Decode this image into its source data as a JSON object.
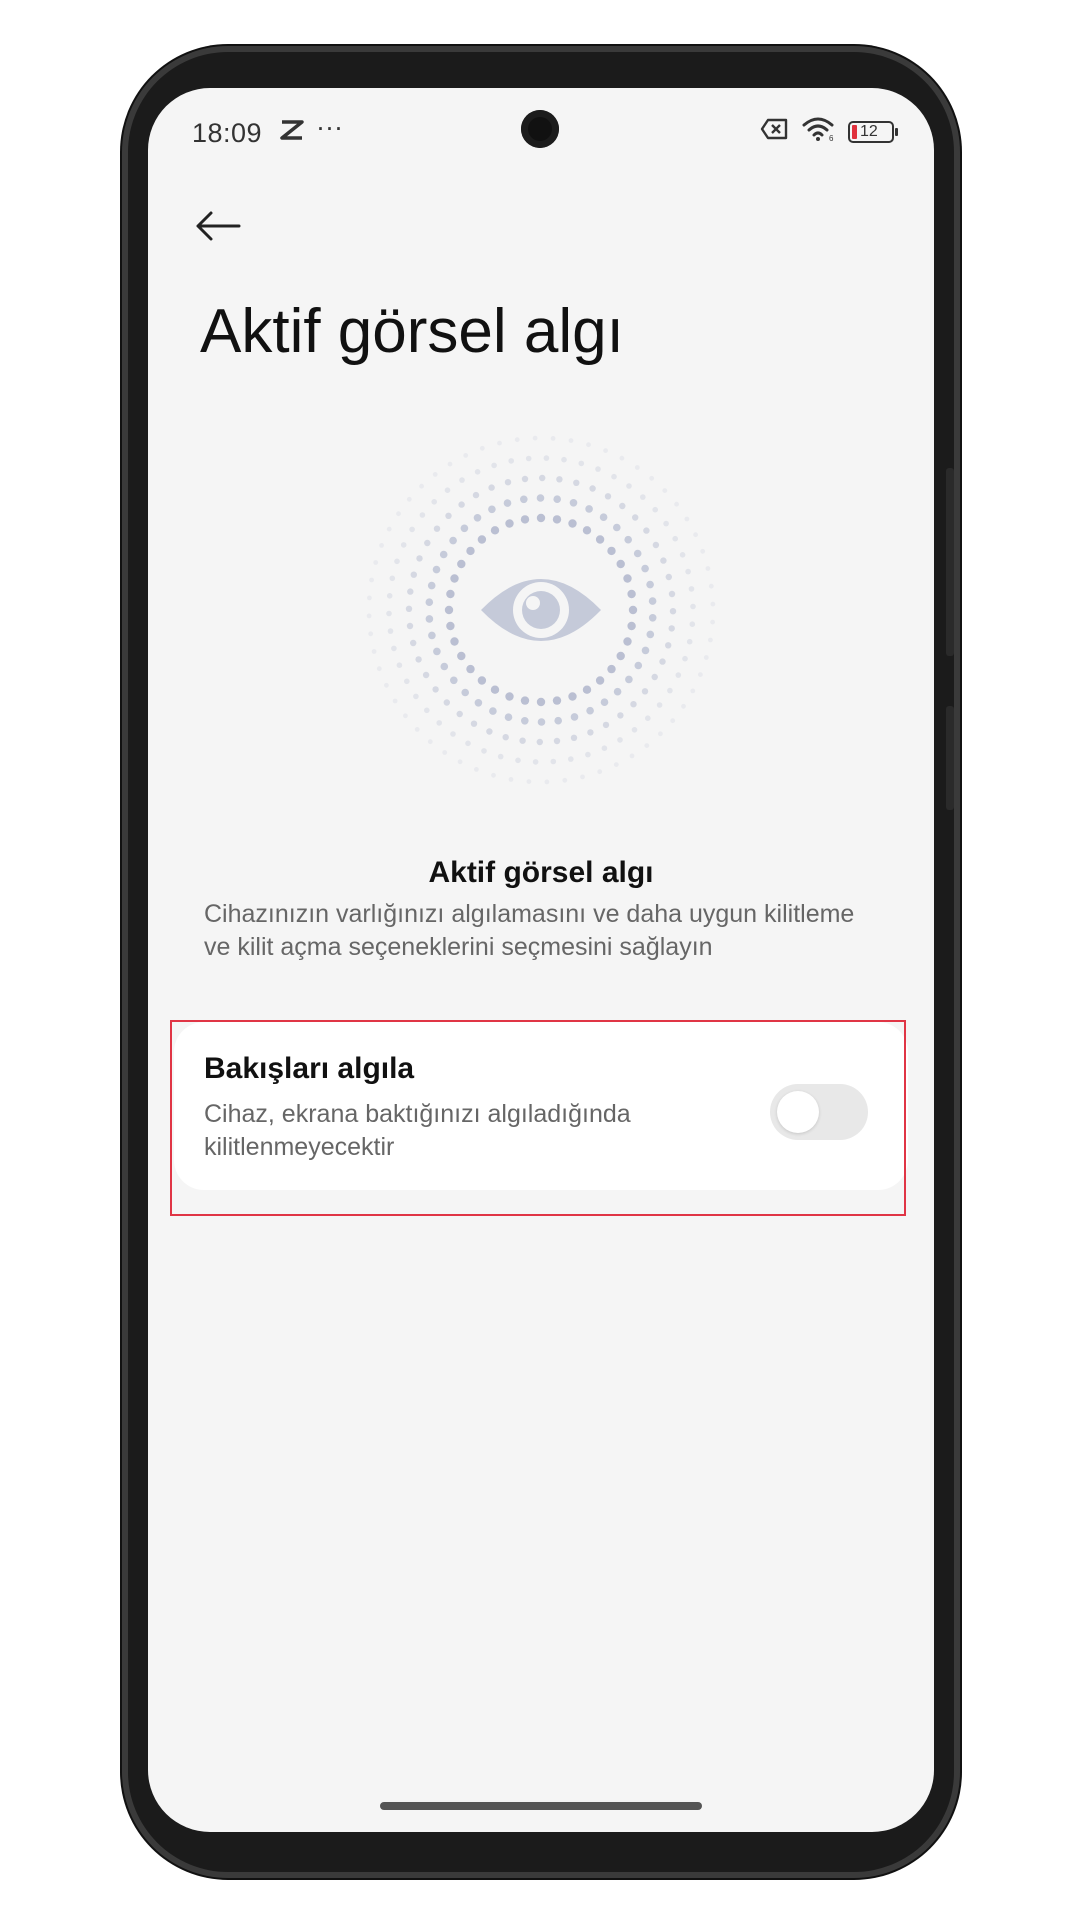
{
  "status_bar": {
    "time": "18:09",
    "extra_icon": "capcut-icon",
    "more": "···",
    "battery_level": "12",
    "icons": [
      "sim-off-icon",
      "wifi-icon",
      "battery-icon"
    ]
  },
  "header": {
    "back_icon": "back-arrow-icon",
    "title": "Aktif görsel algı"
  },
  "illustration": {
    "icon": "eye-icon",
    "color": "#c5cad9"
  },
  "section": {
    "title": "Aktif görsel algı",
    "description": "Cihazınızın varlığınızı algılamasını ve daha uygun kilitleme ve kilit açma seçeneklerini seçmesini sağlayın"
  },
  "setting": {
    "title": "Bakışları algıla",
    "description": "Cihaz, ekrana baktığınızı algıladığında kilitlenmeyecektir",
    "toggle_on": false
  },
  "colors": {
    "highlight": "#e03545",
    "background": "#f5f5f5",
    "toggle_off": "#e8e8e8"
  }
}
